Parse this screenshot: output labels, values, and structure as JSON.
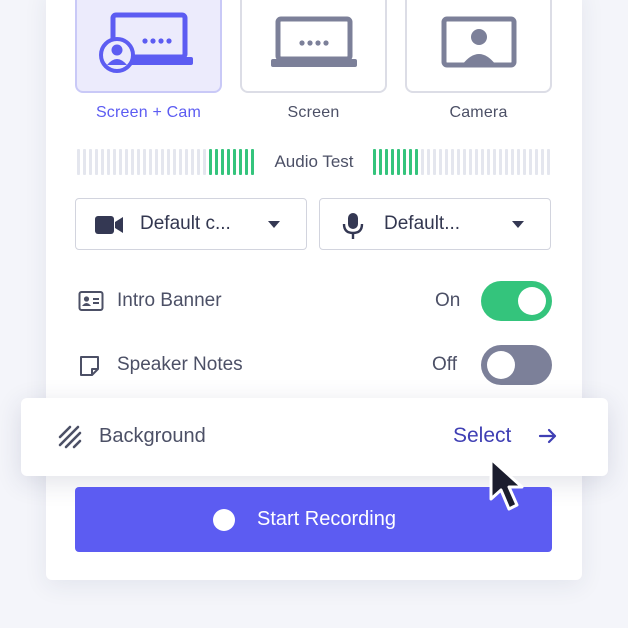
{
  "modes": [
    {
      "label": "Screen + Cam",
      "selected": true,
      "icon": "screen-cam-icon"
    },
    {
      "label": "Screen",
      "selected": false,
      "icon": "laptop-icon"
    },
    {
      "label": "Camera",
      "selected": false,
      "icon": "camera-person-icon"
    }
  ],
  "audio_test": {
    "label": "Audio Test"
  },
  "camera_select": {
    "value": "Default c...",
    "icon": "video-camera-icon"
  },
  "mic_select": {
    "value": "Default...",
    "icon": "microphone-icon"
  },
  "intro_banner": {
    "label": "Intro Banner",
    "state": "On",
    "enabled": true,
    "icon": "id-card-icon"
  },
  "speaker_notes": {
    "label": "Speaker Notes",
    "state": "Off",
    "enabled": false,
    "icon": "note-icon"
  },
  "background": {
    "label": "Background",
    "action": "Select",
    "icon": "squiggle-icon"
  },
  "start": {
    "label": "Start Recording"
  },
  "colors": {
    "accent": "#5c5cf2",
    "green": "#34c47c",
    "toggle_off": "#7c8099",
    "select_link": "#3f3fb4"
  }
}
